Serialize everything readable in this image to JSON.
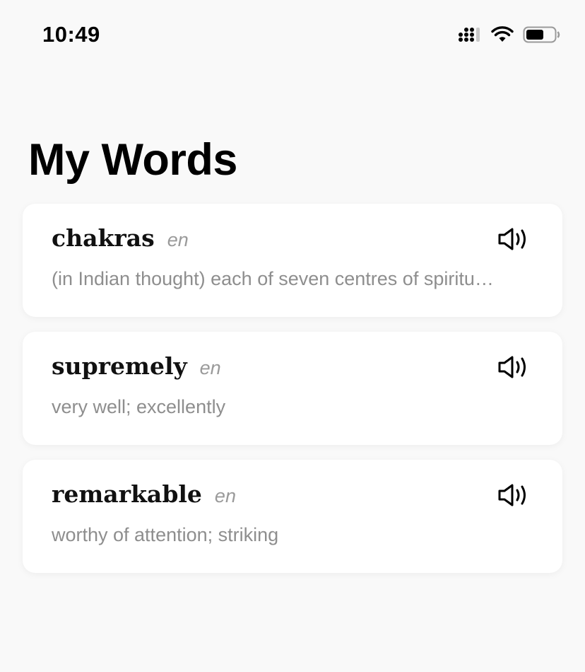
{
  "status_bar": {
    "time": "10:49",
    "icons": [
      "cellular-signal-icon",
      "wifi-icon",
      "battery-icon"
    ]
  },
  "page": {
    "title": "My Words"
  },
  "words": [
    {
      "term": "chakras",
      "lang": "en",
      "definition": "(in Indian thought) each of seven centres of spiritu…",
      "action_icon": "speaker-icon"
    },
    {
      "term": "supremely",
      "lang": "en",
      "definition": "very well; excellently",
      "action_icon": "speaker-icon"
    },
    {
      "term": "remarkable",
      "lang": "en",
      "definition": "worthy of attention; striking",
      "action_icon": "speaker-icon"
    }
  ],
  "colors": {
    "background": "#f9f9f9",
    "card": "#ffffff",
    "secondary_text": "#8e8e8e"
  }
}
